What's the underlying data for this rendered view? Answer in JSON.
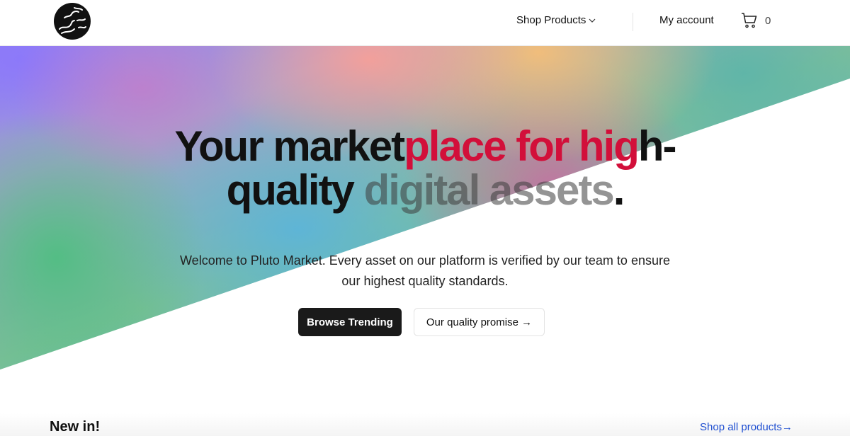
{
  "header": {
    "logo_name": "globe-logo",
    "nav": {
      "shop_products": "Shop Products",
      "my_account": "My account",
      "cart_count": "0"
    }
  },
  "hero": {
    "title": {
      "part1": "Your market",
      "part2": "place for hig",
      "part3": "h-",
      "part4": "quality ",
      "part5": "digital assets",
      "part6": "."
    },
    "description": "Welcome to Pluto Market. Every asset on our platform is verified by our team to ensure our highest quality standards.",
    "primary_button": "Browse Trending",
    "secondary_button": "Our quality promise →"
  },
  "new_in": {
    "title": "New in!",
    "shop_all_link": "Shop all products→"
  },
  "colors": {
    "accent_link": "#1f4fd1",
    "primary_button_bg": "#1a1a1a"
  }
}
